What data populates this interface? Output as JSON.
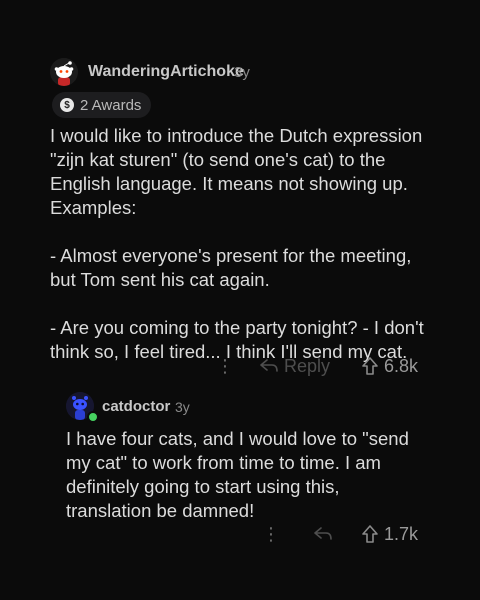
{
  "comment": {
    "username": "WanderingArtichoke",
    "age": "3y",
    "awards_label": "2 Awards",
    "award_icon": "award-icon",
    "paragraphs": [
      "I would like to introduce the Dutch expression \"zijn kat sturen\" (to send one's cat) to the English language. It means not showing up. Examples:",
      "- Almost everyone's present for the meeting, but Tom sent his cat again.",
      "- Are you coming to the party tonight? - I don't think so, I feel tired... I think I'll send my cat."
    ],
    "actions": {
      "more_icon": "more-dots-icon",
      "reply_icon": "reply-arrow-icon",
      "reply_label": "Reply",
      "upvote_icon": "upvote-arrow-icon",
      "score": "6.8k"
    }
  },
  "reply": {
    "username": "catdoctor",
    "age": "3y",
    "online_status_color": "#46d160",
    "paragraphs": [
      "I have four cats, and I would love to \"send my cat\" to work from time to time. I am definitely going to start using this, translation be damned!"
    ],
    "actions": {
      "more_icon": "more-dots-icon",
      "reply_icon": "reply-arrow-icon",
      "upvote_icon": "upvote-arrow-icon",
      "score": "1.7k"
    }
  },
  "colors": {
    "background": "#0b0b0b",
    "text": "#dcdcdc",
    "muted": "#8a8a8a",
    "award_pill": "#1d1d1f"
  }
}
